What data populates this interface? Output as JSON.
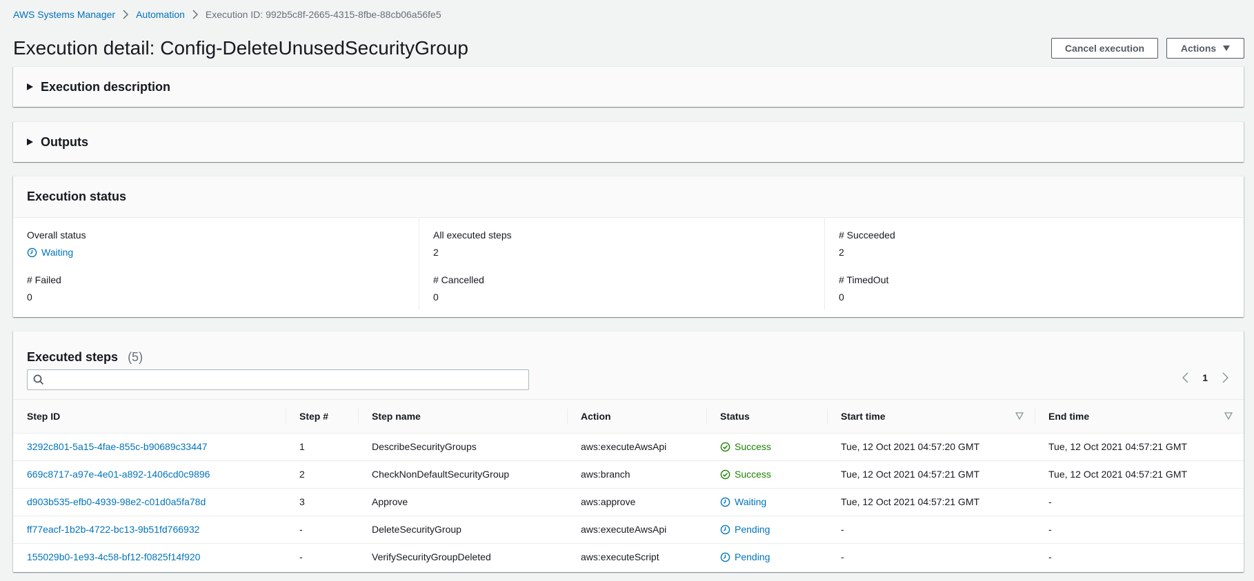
{
  "breadcrumb": {
    "items": [
      "AWS Systems Manager",
      "Automation"
    ],
    "current": "Execution ID: 992b5c8f-2665-4315-8fbe-88cb06a56fe5"
  },
  "page_title": "Execution detail: Config-DeleteUnusedSecurityGroup",
  "actions": {
    "cancel_label": "Cancel execution",
    "actions_label": "Actions"
  },
  "sections": {
    "execution_description": "Execution description",
    "outputs": "Outputs"
  },
  "execution_status": {
    "title": "Execution status",
    "overall_status_label": "Overall status",
    "overall_status_value": "Waiting",
    "all_steps_label": "All executed steps",
    "all_steps_value": "2",
    "succeeded_label": "# Succeeded",
    "succeeded_value": "2",
    "failed_label": "# Failed",
    "failed_value": "0",
    "cancelled_label": "# Cancelled",
    "cancelled_value": "0",
    "timedout_label": "# TimedOut",
    "timedout_value": "0"
  },
  "executed_steps": {
    "title": "Executed steps",
    "count": "(5)",
    "search_placeholder": "",
    "page": "1",
    "columns": [
      "Step ID",
      "Step #",
      "Step name",
      "Action",
      "Status",
      "Start time",
      "End time"
    ],
    "rows": [
      {
        "id": "3292c801-5a15-4fae-855c-b90689c33447",
        "num": "1",
        "name": "DescribeSecurityGroups",
        "action": "aws:executeAwsApi",
        "status": "Success",
        "status_type": "success",
        "start": "Tue, 12 Oct 2021 04:57:20 GMT",
        "end": "Tue, 12 Oct 2021 04:57:21 GMT"
      },
      {
        "id": "669c8717-a97e-4e01-a892-1406cd0c9896",
        "num": "2",
        "name": "CheckNonDefaultSecurityGroup",
        "action": "aws:branch",
        "status": "Success",
        "status_type": "success",
        "start": "Tue, 12 Oct 2021 04:57:21 GMT",
        "end": "Tue, 12 Oct 2021 04:57:21 GMT"
      },
      {
        "id": "d903b535-efb0-4939-98e2-c01d0a5fa78d",
        "num": "3",
        "name": "Approve",
        "action": "aws:approve",
        "status": "Waiting",
        "status_type": "waiting",
        "start": "Tue, 12 Oct 2021 04:57:21 GMT",
        "end": "-"
      },
      {
        "id": "ff77eacf-1b2b-4722-bc13-9b51fd766932",
        "num": "-",
        "name": "DeleteSecurityGroup",
        "action": "aws:executeAwsApi",
        "status": "Pending",
        "status_type": "pending",
        "start": "-",
        "end": "-"
      },
      {
        "id": "155029b0-1e93-4c58-bf12-f0825f14f920",
        "num": "-",
        "name": "VerifySecurityGroupDeleted",
        "action": "aws:executeScript",
        "status": "Pending",
        "status_type": "pending",
        "start": "-",
        "end": "-"
      }
    ]
  },
  "colors": {
    "link": "#0073bb",
    "success": "#1d8102",
    "waiting": "#0073bb",
    "background": "#f2f3f3"
  }
}
